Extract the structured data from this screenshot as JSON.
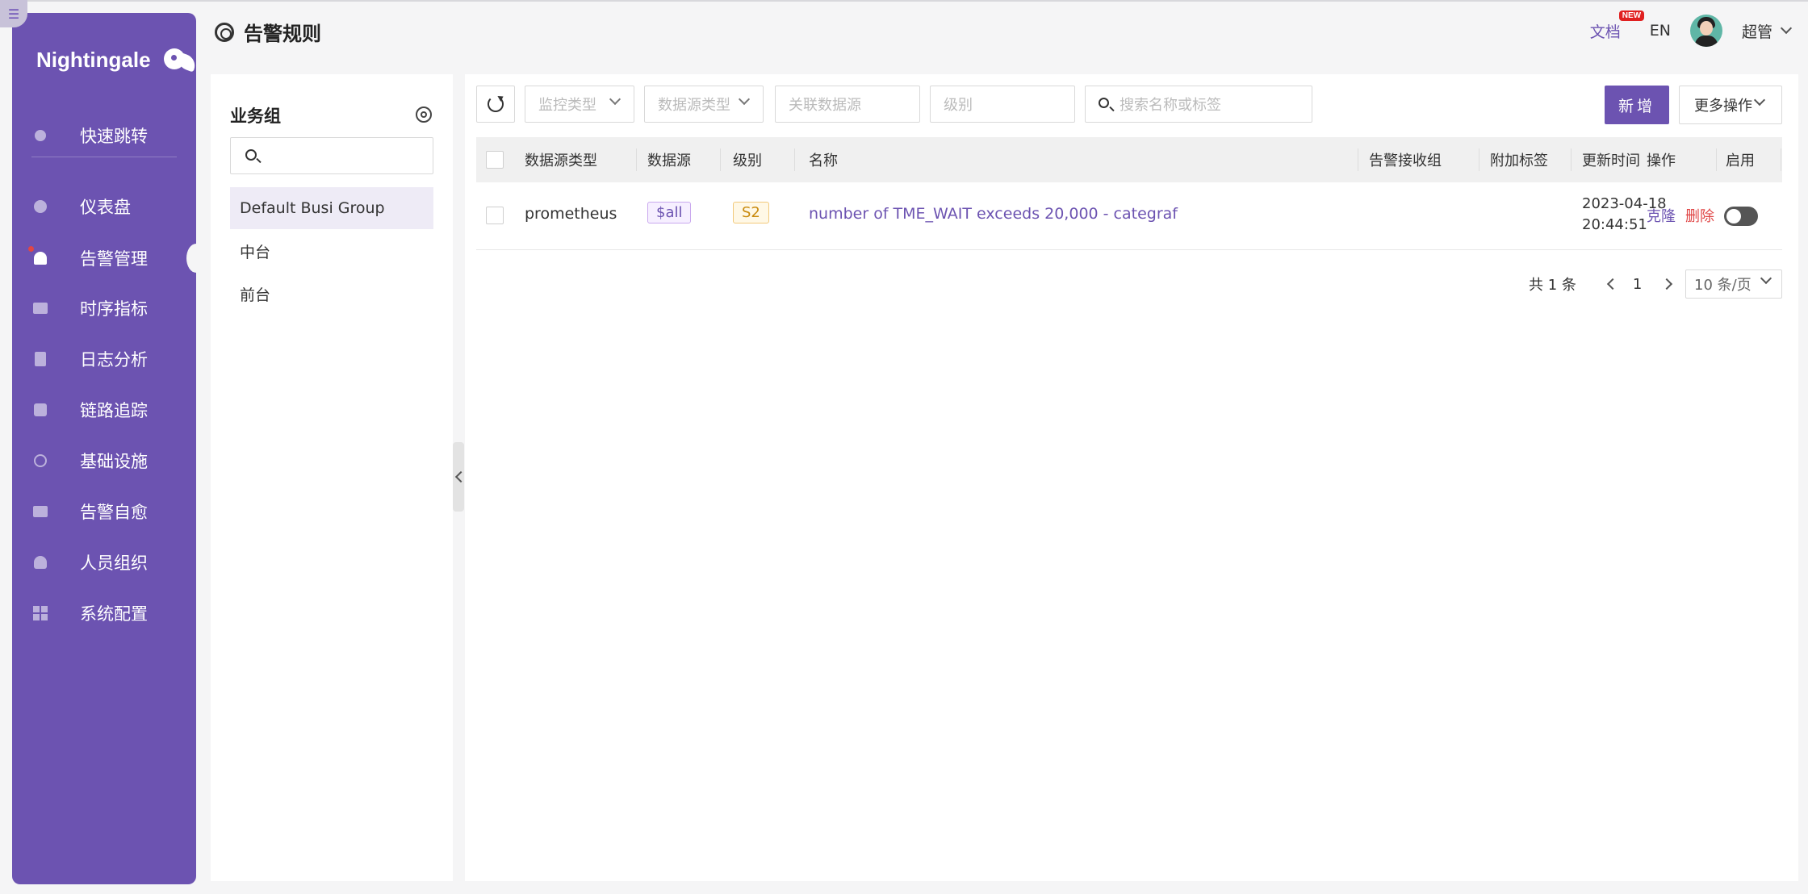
{
  "app": {
    "name": "Nightingale"
  },
  "sidebar": {
    "items": [
      {
        "label": "快速跳转",
        "icon": "search-icon"
      },
      {
        "label": "仪表盘",
        "icon": "dashboard-icon"
      },
      {
        "label": "告警管理",
        "icon": "alarm-icon",
        "active": true
      },
      {
        "label": "时序指标",
        "icon": "line-chart-icon"
      },
      {
        "label": "日志分析",
        "icon": "log-icon"
      },
      {
        "label": "链路追踪",
        "icon": "link-icon"
      },
      {
        "label": "基础设施",
        "icon": "target-icon"
      },
      {
        "label": "告警自愈",
        "icon": "terminal-icon"
      },
      {
        "label": "人员组织",
        "icon": "user-icon"
      },
      {
        "label": "系统配置",
        "icon": "grid-icon"
      }
    ]
  },
  "header": {
    "title": "告警规则",
    "docs": "文档",
    "docs_badge": "NEW",
    "lang": "EN",
    "user": "超管"
  },
  "groups": {
    "title": "业务组",
    "search_value": "",
    "items": [
      "Default Busi Group",
      "中台",
      "前台"
    ]
  },
  "toolbar": {
    "filter_monitor_type": "监控类型",
    "filter_datasource_type": "数据源类型",
    "filter_related_datasource": "关联数据源",
    "filter_severity": "级别",
    "search_placeholder": "搜索名称或标签",
    "add_label": "新增",
    "more_label": "更多操作"
  },
  "table": {
    "columns": [
      "数据源类型",
      "数据源",
      "级别",
      "名称",
      "告警接收组",
      "附加标签",
      "更新时间",
      "启用",
      "操作"
    ],
    "rows": [
      {
        "datasource_type": "prometheus",
        "datasource": "$all",
        "severity": "S2",
        "name": "number of TME_WAIT exceeds 20,000 - categraf",
        "notify_groups": "",
        "extra_labels": "",
        "updated_date": "2023-04-18",
        "updated_time": "20:44:51",
        "enabled": false,
        "op_clone": "克隆",
        "op_delete": "删除"
      }
    ]
  },
  "pagination": {
    "total_text": "共 1 条",
    "current_page": "1",
    "page_size": "10 条/页"
  },
  "colors": {
    "brand": "#6c53b1",
    "danger": "#e04646"
  }
}
